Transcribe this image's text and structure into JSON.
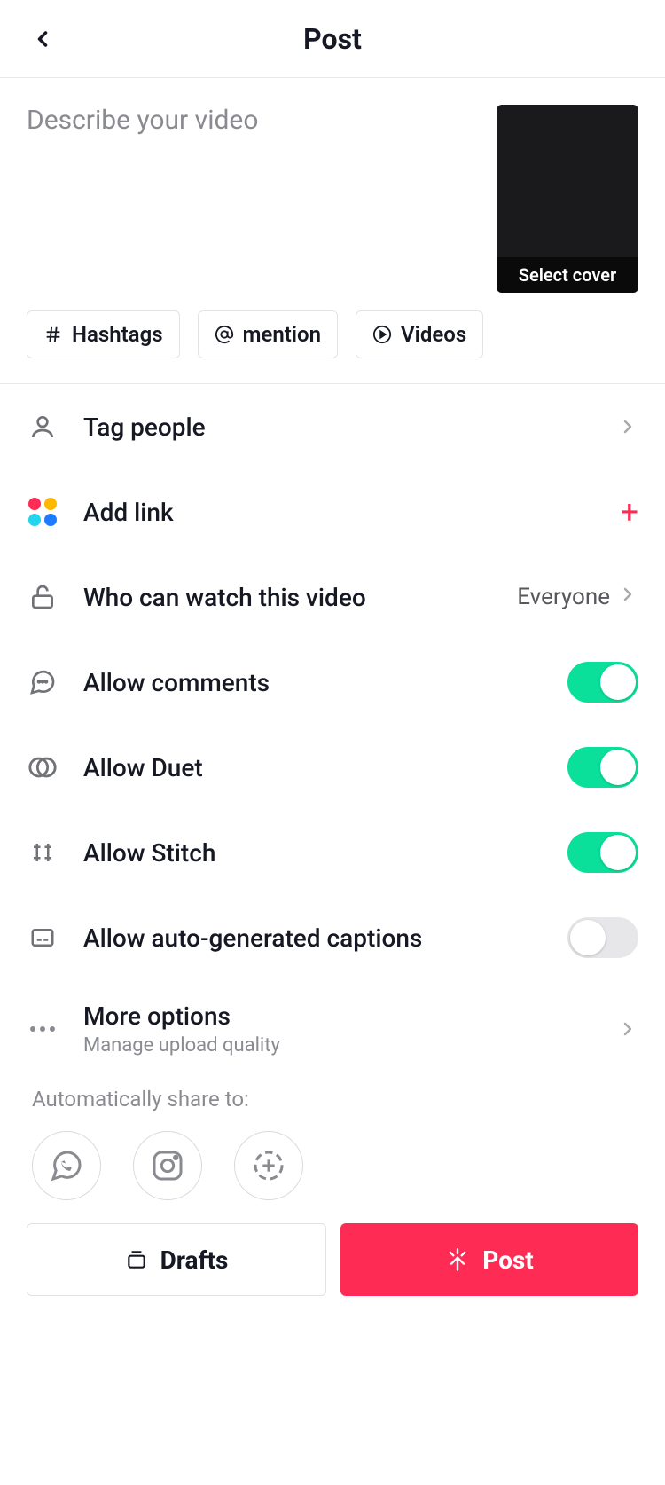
{
  "header": {
    "title": "Post"
  },
  "compose": {
    "placeholder": "Describe your video",
    "select_cover": "Select cover"
  },
  "chips": {
    "hashtags": "Hashtags",
    "mention": "mention",
    "videos": "Videos"
  },
  "rows": {
    "tag_people": "Tag people",
    "add_link": "Add link",
    "privacy_label": "Who can watch this video",
    "privacy_value": "Everyone",
    "allow_comments": "Allow comments",
    "allow_duet": "Allow Duet",
    "allow_stitch": "Allow Stitch",
    "allow_captions": "Allow auto-generated captions",
    "more_options": "More options",
    "more_sub": "Manage upload quality"
  },
  "toggles": {
    "comments": true,
    "duet": true,
    "stitch": true,
    "captions": false
  },
  "share": {
    "label": "Automatically share to:"
  },
  "buttons": {
    "drafts": "Drafts",
    "post": "Post"
  }
}
